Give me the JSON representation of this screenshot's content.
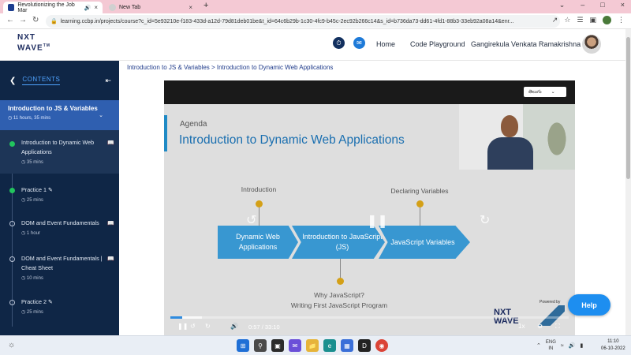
{
  "browser": {
    "tabs": [
      {
        "title": "Revolutionizing the Job Mar"
      },
      {
        "title": "New Tab"
      }
    ],
    "url": "learning.ccbp.in/projects/course?c_id=5e93210e-f183-433d-a12d-79d81deb01be&t_id=64c6b29b-1c30-4fc9-b45c-2ec92b266c14&s_id=b736da73-dd61-4fd1-88b3-33eb92a08a14&enr..."
  },
  "header": {
    "logo_line1": "NXT",
    "logo_line2": "WAVE",
    "logo_tm": "TM",
    "home": "Home",
    "code_playground": "Code Playground",
    "user_name": "Gangirekula Venkata Ramakrishna"
  },
  "sidebar": {
    "contents_label": "CONTENTS",
    "module": {
      "title": "Introduction to JS & Variables",
      "duration": "11 hours, 35 mins"
    },
    "items": [
      {
        "label": "Introduction to Dynamic Web Applications",
        "meta": "35 mins",
        "status": "done",
        "icon": "book-icon"
      },
      {
        "label": "Practice 1",
        "meta": "25 mins",
        "status": "done",
        "icon": "pencil-icon"
      },
      {
        "label": "DOM and Event Fundamentals",
        "meta": "1 hour",
        "status": "todo",
        "icon": "book-icon"
      },
      {
        "label": "DOM and Event Fundamentals | Cheat Sheet",
        "meta": "10 mins",
        "status": "todo",
        "icon": "book-icon"
      },
      {
        "label": "Practice 2",
        "meta": "25 mins",
        "status": "todo",
        "icon": "pencil-icon"
      }
    ]
  },
  "main": {
    "breadcrumb": "Introduction to JS & Variables > Introduction to Dynamic Web Applications",
    "language": "తెలుగు"
  },
  "slide": {
    "agenda": "Agenda",
    "title": "Introduction to Dynamic Web Applications",
    "top_labels": [
      "Introduction",
      "Declaring Variables"
    ],
    "steps": [
      "Dynamic Web Applications",
      "Introduction to JavaScript (JS)",
      "JavaScript Variables"
    ],
    "bottom_label_1": "Why JavaScript?",
    "bottom_label_2": "Writing First JavaScript Program",
    "brand1": "NXT",
    "brand2": "WAVE",
    "powered": "Powered by"
  },
  "player": {
    "current_time": "0:57",
    "duration": "33:10",
    "progress_fraction": 0.029,
    "speed": "1x"
  },
  "help_label": "Help",
  "taskbar": {
    "lang1": "ENG",
    "lang2": "IN",
    "time": "11:10",
    "date": "06-10-2022"
  },
  "colors": {
    "sidebar_bg": "#0f2646",
    "module_bg": "#2f5fb0",
    "accent_blue": "#1e7ad8",
    "slide_chevron": "#3897d1",
    "help_button": "#1d8ef0"
  }
}
